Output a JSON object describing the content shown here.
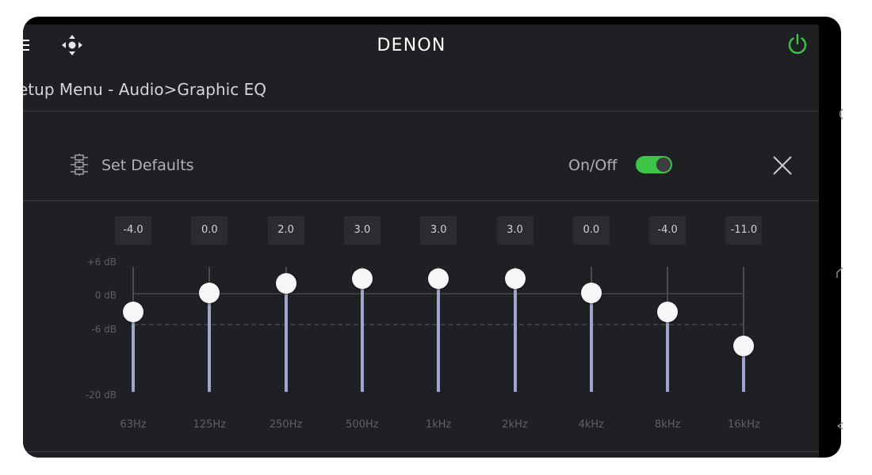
{
  "header": {
    "brand": "DENON",
    "breadcrumb": "etup Menu - Audio>Graphic EQ"
  },
  "toolbar": {
    "set_defaults_label": "Set Defaults",
    "onoff_label": "On/Off",
    "toggle_on": true
  },
  "eq": {
    "axis_labels": {
      "plus6": "+6 dB",
      "zero": "0 dB",
      "minus6": "-6 dB",
      "minus20": "-20 dB"
    },
    "bands": [
      {
        "freq": "63Hz",
        "value_label": "-4.0",
        "value": -4.0
      },
      {
        "freq": "125Hz",
        "value_label": "0.0",
        "value": 0.0
      },
      {
        "freq": "250Hz",
        "value_label": "2.0",
        "value": 2.0
      },
      {
        "freq": "500Hz",
        "value_label": "3.0",
        "value": 3.0
      },
      {
        "freq": "1kHz",
        "value_label": "3.0",
        "value": 3.0
      },
      {
        "freq": "2kHz",
        "value_label": "3.0",
        "value": 3.0
      },
      {
        "freq": "4kHz",
        "value_label": "0.0",
        "value": 0.0
      },
      {
        "freq": "8kHz",
        "value_label": "-4.0",
        "value": -4.0
      },
      {
        "freq": "16kHz",
        "value_label": "-11.0",
        "value": -11.0
      }
    ]
  },
  "colors": {
    "accent_green": "#3ec447",
    "slider_fill": "#9ea6cc",
    "background": "#1f2023"
  }
}
